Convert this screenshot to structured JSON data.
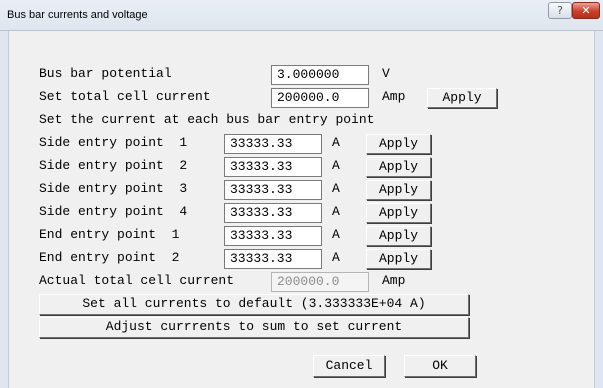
{
  "window": {
    "title": "Bus bar currents and voltage",
    "help_glyph": "?",
    "close_glyph": "✕"
  },
  "potential": {
    "label": "Bus bar potential",
    "value": "3.000000",
    "unit": "V"
  },
  "total": {
    "label": "Set total cell current",
    "value": "200000.0",
    "unit": "Amp",
    "apply_label": "Apply"
  },
  "section_label": "Set the current at each bus bar entry point",
  "entries": [
    {
      "label": "Side entry point  1",
      "value": "33333.33",
      "unit": "A",
      "apply_label": "Apply"
    },
    {
      "label": "Side entry point  2",
      "value": "33333.33",
      "unit": "A",
      "apply_label": "Apply"
    },
    {
      "label": "Side entry point  3",
      "value": "33333.33",
      "unit": "A",
      "apply_label": "Apply"
    },
    {
      "label": "Side entry point  4",
      "value": "33333.33",
      "unit": "A",
      "apply_label": "Apply"
    },
    {
      "label": "End entry point  1",
      "value": "33333.33",
      "unit": "A",
      "apply_label": "Apply"
    },
    {
      "label": "End entry point  2",
      "value": "33333.33",
      "unit": "A",
      "apply_label": "Apply"
    }
  ],
  "actual": {
    "label": "Actual total cell current",
    "value": "200000.0",
    "unit": "Amp"
  },
  "buttons": {
    "set_default": "Set all currents to default (3.333333E+04 A)",
    "adjust": "Adjust currrents to sum to set current",
    "cancel": "Cancel",
    "ok": "OK"
  }
}
